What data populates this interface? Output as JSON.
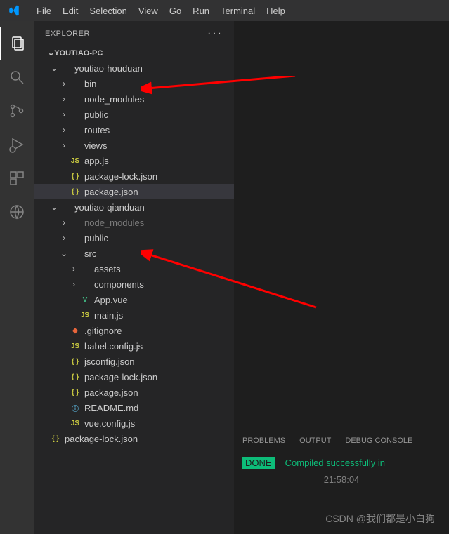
{
  "menubar": {
    "items": [
      "File",
      "Edit",
      "Selection",
      "View",
      "Go",
      "Run",
      "Terminal",
      "Help"
    ]
  },
  "sidebar": {
    "title": "EXPLORER",
    "workspace": "YOUTIAO-PC"
  },
  "tree": [
    {
      "depth": 1,
      "type": "folder",
      "open": true,
      "name": "youtiao-houduan"
    },
    {
      "depth": 2,
      "type": "folder",
      "open": false,
      "name": "bin"
    },
    {
      "depth": 2,
      "type": "folder",
      "open": false,
      "name": "node_modules"
    },
    {
      "depth": 2,
      "type": "folder",
      "open": false,
      "name": "public"
    },
    {
      "depth": 2,
      "type": "folder",
      "open": false,
      "name": "routes"
    },
    {
      "depth": 2,
      "type": "folder",
      "open": false,
      "name": "views"
    },
    {
      "depth": 2,
      "type": "file",
      "icon": "js",
      "name": "app.js"
    },
    {
      "depth": 2,
      "type": "file",
      "icon": "json",
      "name": "package-lock.json"
    },
    {
      "depth": 2,
      "type": "file",
      "icon": "json",
      "name": "package.json",
      "selected": true
    },
    {
      "depth": 1,
      "type": "folder",
      "open": true,
      "name": "youtiao-qianduan"
    },
    {
      "depth": 2,
      "type": "folder",
      "open": false,
      "name": "node_modules",
      "dimmed": true
    },
    {
      "depth": 2,
      "type": "folder",
      "open": false,
      "name": "public"
    },
    {
      "depth": 2,
      "type": "folder",
      "open": true,
      "name": "src"
    },
    {
      "depth": 3,
      "type": "folder",
      "open": false,
      "name": "assets"
    },
    {
      "depth": 3,
      "type": "folder",
      "open": false,
      "name": "components"
    },
    {
      "depth": 3,
      "type": "file",
      "icon": "vue",
      "name": "App.vue"
    },
    {
      "depth": 3,
      "type": "file",
      "icon": "js",
      "name": "main.js"
    },
    {
      "depth": 2,
      "type": "file",
      "icon": "git",
      "name": ".gitignore"
    },
    {
      "depth": 2,
      "type": "file",
      "icon": "js",
      "name": "babel.config.js"
    },
    {
      "depth": 2,
      "type": "file",
      "icon": "json",
      "name": "jsconfig.json"
    },
    {
      "depth": 2,
      "type": "file",
      "icon": "json",
      "name": "package-lock.json"
    },
    {
      "depth": 2,
      "type": "file",
      "icon": "json",
      "name": "package.json"
    },
    {
      "depth": 2,
      "type": "file",
      "icon": "md",
      "name": "README.md"
    },
    {
      "depth": 2,
      "type": "file",
      "icon": "js",
      "name": "vue.config.js"
    },
    {
      "depth": 0,
      "type": "file",
      "icon": "json",
      "name": "package-lock.json"
    }
  ],
  "panel": {
    "tabs": [
      "PROBLEMS",
      "OUTPUT",
      "DEBUG CONSOLE"
    ],
    "done_badge": "DONE",
    "message": "Compiled successfully in",
    "time": "21:58:04"
  },
  "watermark": "CSDN @我们都是小白狗"
}
